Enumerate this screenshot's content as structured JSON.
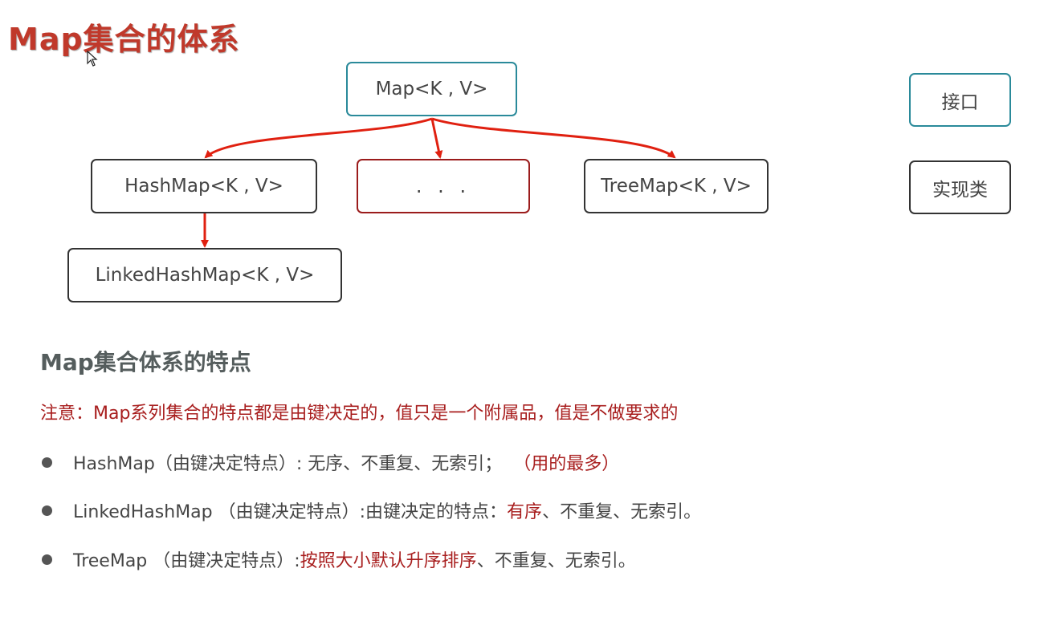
{
  "title": "Map集合的体系",
  "nodes": {
    "map": "Map<K , V>",
    "hashmap": "HashMap<K , V>",
    "ellipsis": ". . .",
    "treemap": "TreeMap<K , V>",
    "linkedhashmap": "LinkedHashMap<K , V>"
  },
  "legend": {
    "interface": "接口",
    "impl": "实现类"
  },
  "features": {
    "heading": "Map集合体系的特点",
    "note": "注意：Map系列集合的特点都是由键决定的，值只是一个附属品，值是不做要求的",
    "items": [
      {
        "prefix": "HashMap（由键决定特点）: 无序、不重复、无索引；",
        "highlight": "（用的最多）",
        "suffix": ""
      },
      {
        "prefix": "LinkedHashMap （由键决定特点）:由键决定的特点：",
        "highlight": "有序",
        "suffix": "、不重复、无索引。"
      },
      {
        "prefix": "TreeMap （由键决定特点）:",
        "highlight": "按照大小默认升序排序",
        "suffix": "、不重复、无索引。"
      }
    ]
  },
  "colors": {
    "title": "#c0392b",
    "interface_border": "#2a8a9a",
    "impl_border": "#333333",
    "arrow": "#e02010",
    "highlight": "#a81e1e"
  }
}
